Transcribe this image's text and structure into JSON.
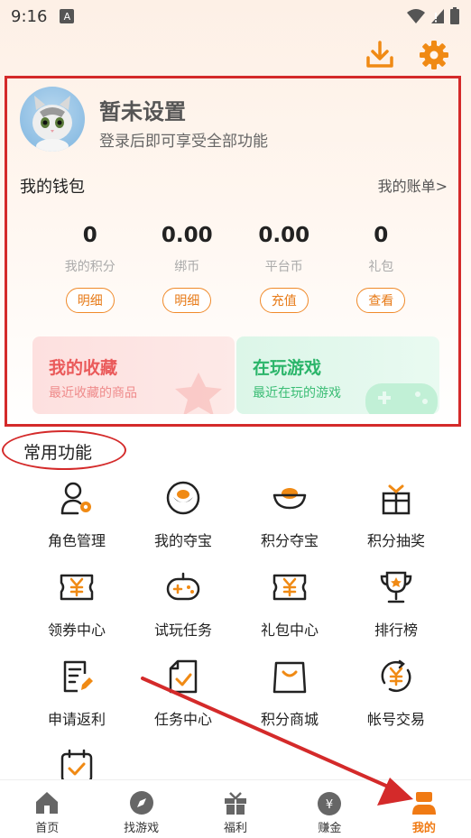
{
  "status": {
    "time": "9:16",
    "a_label": "A"
  },
  "profile": {
    "nickname": "暂未设置",
    "login_tip": "登录后即可享受全部功能"
  },
  "wallet": {
    "title": "我的钱包",
    "bill_link": "我的账单>",
    "items": [
      {
        "value": "0",
        "label": "我的积分",
        "button": "明细"
      },
      {
        "value": "0.00",
        "label": "绑币",
        "button": "明细"
      },
      {
        "value": "0.00",
        "label": "平台币",
        "button": "充值"
      },
      {
        "value": "0",
        "label": "礼包",
        "button": "查看"
      }
    ]
  },
  "cards": {
    "favorites": {
      "title": "我的收藏",
      "subtitle": "最近收藏的商品"
    },
    "playing": {
      "title": "在玩游戏",
      "subtitle": "最近在玩的游戏"
    }
  },
  "functions": {
    "title": "常用功能",
    "items": [
      {
        "label": "角色管理",
        "icon": "user-gear-icon"
      },
      {
        "label": "我的夺宝",
        "icon": "gold-ingot-circle-icon"
      },
      {
        "label": "积分夺宝",
        "icon": "gold-ingot-icon"
      },
      {
        "label": "积分抽奖",
        "icon": "gift-box-icon"
      },
      {
        "label": "领券中心",
        "icon": "yen-coupon-icon"
      },
      {
        "label": "试玩任务",
        "icon": "gamepad-icon"
      },
      {
        "label": "礼包中心",
        "icon": "yen-ticket-icon"
      },
      {
        "label": "排行榜",
        "icon": "trophy-icon"
      },
      {
        "label": "申请返利",
        "icon": "document-edit-icon"
      },
      {
        "label": "任务中心",
        "icon": "task-check-icon"
      },
      {
        "label": "积分商城",
        "icon": "shopping-bag-icon"
      },
      {
        "label": "帐号交易",
        "icon": "yen-exchange-icon"
      },
      {
        "label": "",
        "icon": "calendar-check-icon"
      }
    ]
  },
  "tabbar": {
    "items": [
      {
        "label": "首页",
        "icon": "home-icon"
      },
      {
        "label": "找游戏",
        "icon": "compass-icon"
      },
      {
        "label": "福利",
        "icon": "gift-icon"
      },
      {
        "label": "赚金",
        "icon": "money-bag-icon"
      },
      {
        "label": "我的",
        "icon": "profile-icon"
      }
    ],
    "active": 4
  },
  "colors": {
    "accent": "#f07a13",
    "annotation_red": "#d42a2a",
    "fav_red": "#ea5a5a",
    "play_green": "#2bb56a"
  }
}
